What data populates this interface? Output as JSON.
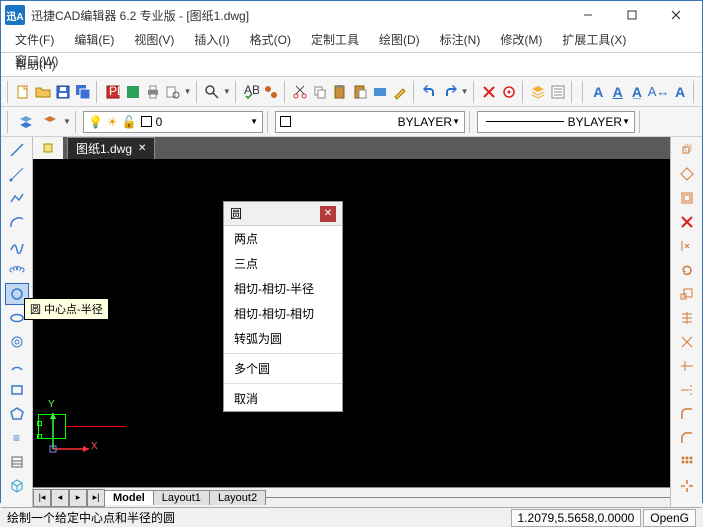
{
  "app": {
    "icon_text": "迅A",
    "title": "迅捷CAD编辑器 6.2 专业版  - [图纸1.dwg]"
  },
  "menu": {
    "file": "文件(F)",
    "edit": "编辑(E)",
    "view": "视图(V)",
    "insert": "插入(I)",
    "format": "格式(O)",
    "custom_tools": "定制工具",
    "draw": "绘图(D)",
    "annotate": "标注(N)",
    "modify": "修改(M)",
    "ext_tools": "扩展工具(X)",
    "window": "窗口(W)",
    "help": "帮助(H)"
  },
  "toolbar": {
    "layer_bylayer": "BYLAYER",
    "linetype_bylayer": "BYLAYER",
    "layer_value": "0"
  },
  "doc_tab": {
    "name": "图纸1.dwg"
  },
  "layout": {
    "model": "Model",
    "l1": "Layout1",
    "l2": "Layout2"
  },
  "context": {
    "title": "圆",
    "two_point": "两点",
    "three_point": "三点",
    "ttr": "相切-相切-半径",
    "ttt": "相切-相切-相切",
    "arc_to_circle": "转弧为圆",
    "multi": "多个圆",
    "cancel": "取消"
  },
  "tooltip": {
    "text": "圆 中心点-半径"
  },
  "status": {
    "hint": "绘制一个给定中心点和半径的圆",
    "coords": "1.2079,5.5658,0.0000",
    "render": "OpenG"
  },
  "ucs": {
    "x": "X",
    "y": "Y"
  }
}
